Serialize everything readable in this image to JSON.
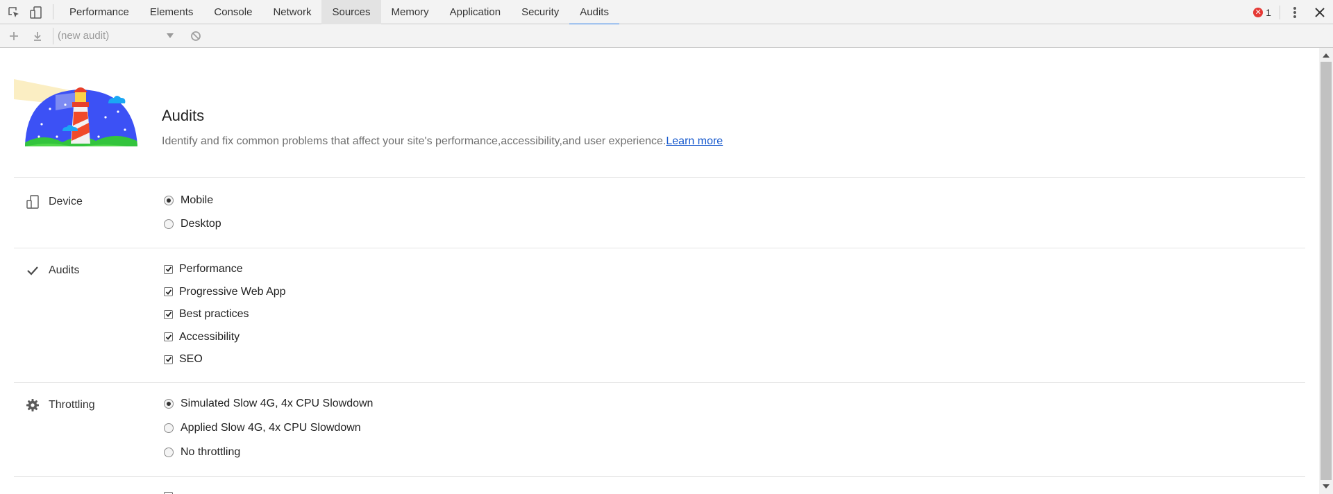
{
  "tabs": [
    {
      "label": "Performance",
      "state": "normal"
    },
    {
      "label": "Elements",
      "state": "normal"
    },
    {
      "label": "Console",
      "state": "normal"
    },
    {
      "label": "Network",
      "state": "normal"
    },
    {
      "label": "Sources",
      "state": "hover"
    },
    {
      "label": "Memory",
      "state": "normal"
    },
    {
      "label": "Application",
      "state": "normal"
    },
    {
      "label": "Security",
      "state": "normal"
    },
    {
      "label": "Audits",
      "state": "selected"
    }
  ],
  "error_count": "1",
  "toolbar": {
    "audit_select": "(new audit)",
    "icons": [
      "plus-icon",
      "download-icon",
      "block-icon"
    ]
  },
  "header": {
    "title": "Audits",
    "description": "Identify and fix common problems that affect your site's performance,accessibility,and user experience.",
    "learn_more": "Learn more"
  },
  "sections": {
    "device": {
      "label": "Device",
      "icon": "device-icon",
      "options": [
        {
          "label": "Mobile",
          "checked": true
        },
        {
          "label": "Desktop",
          "checked": false
        }
      ]
    },
    "audits": {
      "label": "Audits",
      "icon": "checkmark-icon",
      "options": [
        {
          "label": "Performance",
          "checked": true
        },
        {
          "label": "Progressive Web App",
          "checked": true
        },
        {
          "label": "Best practices",
          "checked": true
        },
        {
          "label": "Accessibility",
          "checked": true
        },
        {
          "label": "SEO",
          "checked": true
        }
      ]
    },
    "throttling": {
      "label": "Throttling",
      "icon": "gear-icon",
      "options": [
        {
          "label": "Simulated Slow 4G, 4x CPU Slowdown",
          "checked": true
        },
        {
          "label": "Applied Slow 4G, 4x CPU Slowdown",
          "checked": false
        },
        {
          "label": "No throttling",
          "checked": false
        }
      ]
    }
  },
  "colors": {
    "accent": "#1a73e8",
    "error": "#e53935",
    "link": "#1155cc"
  }
}
